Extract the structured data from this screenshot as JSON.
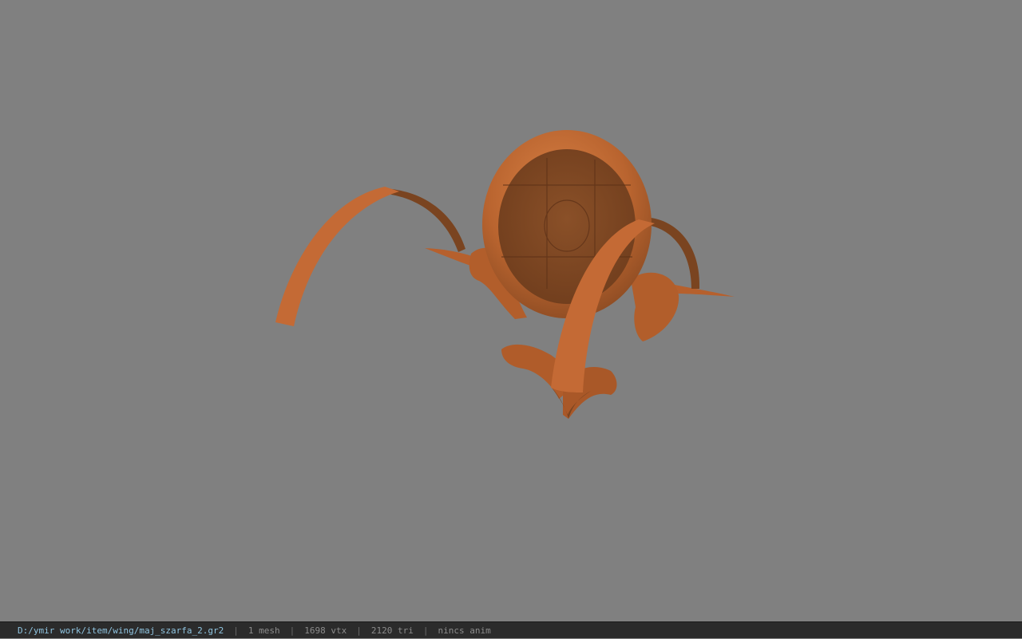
{
  "viewer": {
    "background_color": "#808080",
    "model_color": "#c8703a",
    "model_dark_color": "#7a4420",
    "model_icon": "wing-model-render"
  },
  "statusbar": {
    "file_path": "D:/ymir work/item/wing/maj_szarfa_2.gr2",
    "mesh_count": "1 mesh",
    "vertex_count": "1698 vtx",
    "triangle_count": "2120 tri",
    "anim_status": "nincs anim",
    "separator": "|",
    "path_color": "#8fc4e0"
  }
}
